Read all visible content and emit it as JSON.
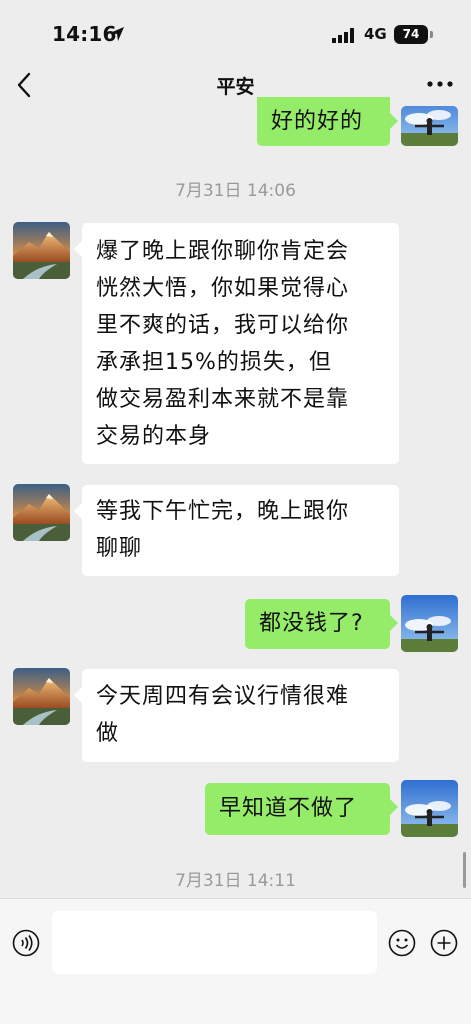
{
  "status_bar": {
    "time": "14:16",
    "network": "4G",
    "battery": "74"
  },
  "nav": {
    "title": "平安",
    "back_icon": "chevron-left-icon",
    "more_icon": "ellipsis-icon"
  },
  "messages": [
    {
      "from": "me",
      "text": "好的好的"
    },
    {
      "type": "time",
      "text": "7月31日 14:06"
    },
    {
      "from": "contact",
      "lines": [
        "爆了晚上跟你聊你肯定会",
        "恍然大悟，你如果觉得心",
        "里不爽的话，我可以给你",
        "承承担15%的损失，但",
        "做交易盈利本来就不是靠",
        "交易的本身"
      ]
    },
    {
      "from": "contact",
      "lines": [
        "等我下午忙完，晚上跟你",
        "聊聊"
      ]
    },
    {
      "from": "me",
      "text": "都没钱了?"
    },
    {
      "from": "contact",
      "lines": [
        "今天周四有会议行情很难",
        "做"
      ]
    },
    {
      "from": "me",
      "text": "早知道不做了"
    },
    {
      "type": "time",
      "text": "7月31日 14:11"
    }
  ],
  "input": {
    "value": "",
    "voice_icon": "voice-icon",
    "emoji_icon": "emoji-icon",
    "plus_icon": "plus-icon"
  },
  "colors": {
    "background": "#ededed",
    "outgoing_bubble": "#95ec69",
    "incoming_bubble": "#ffffff",
    "timestamp": "#9a9a9a"
  }
}
